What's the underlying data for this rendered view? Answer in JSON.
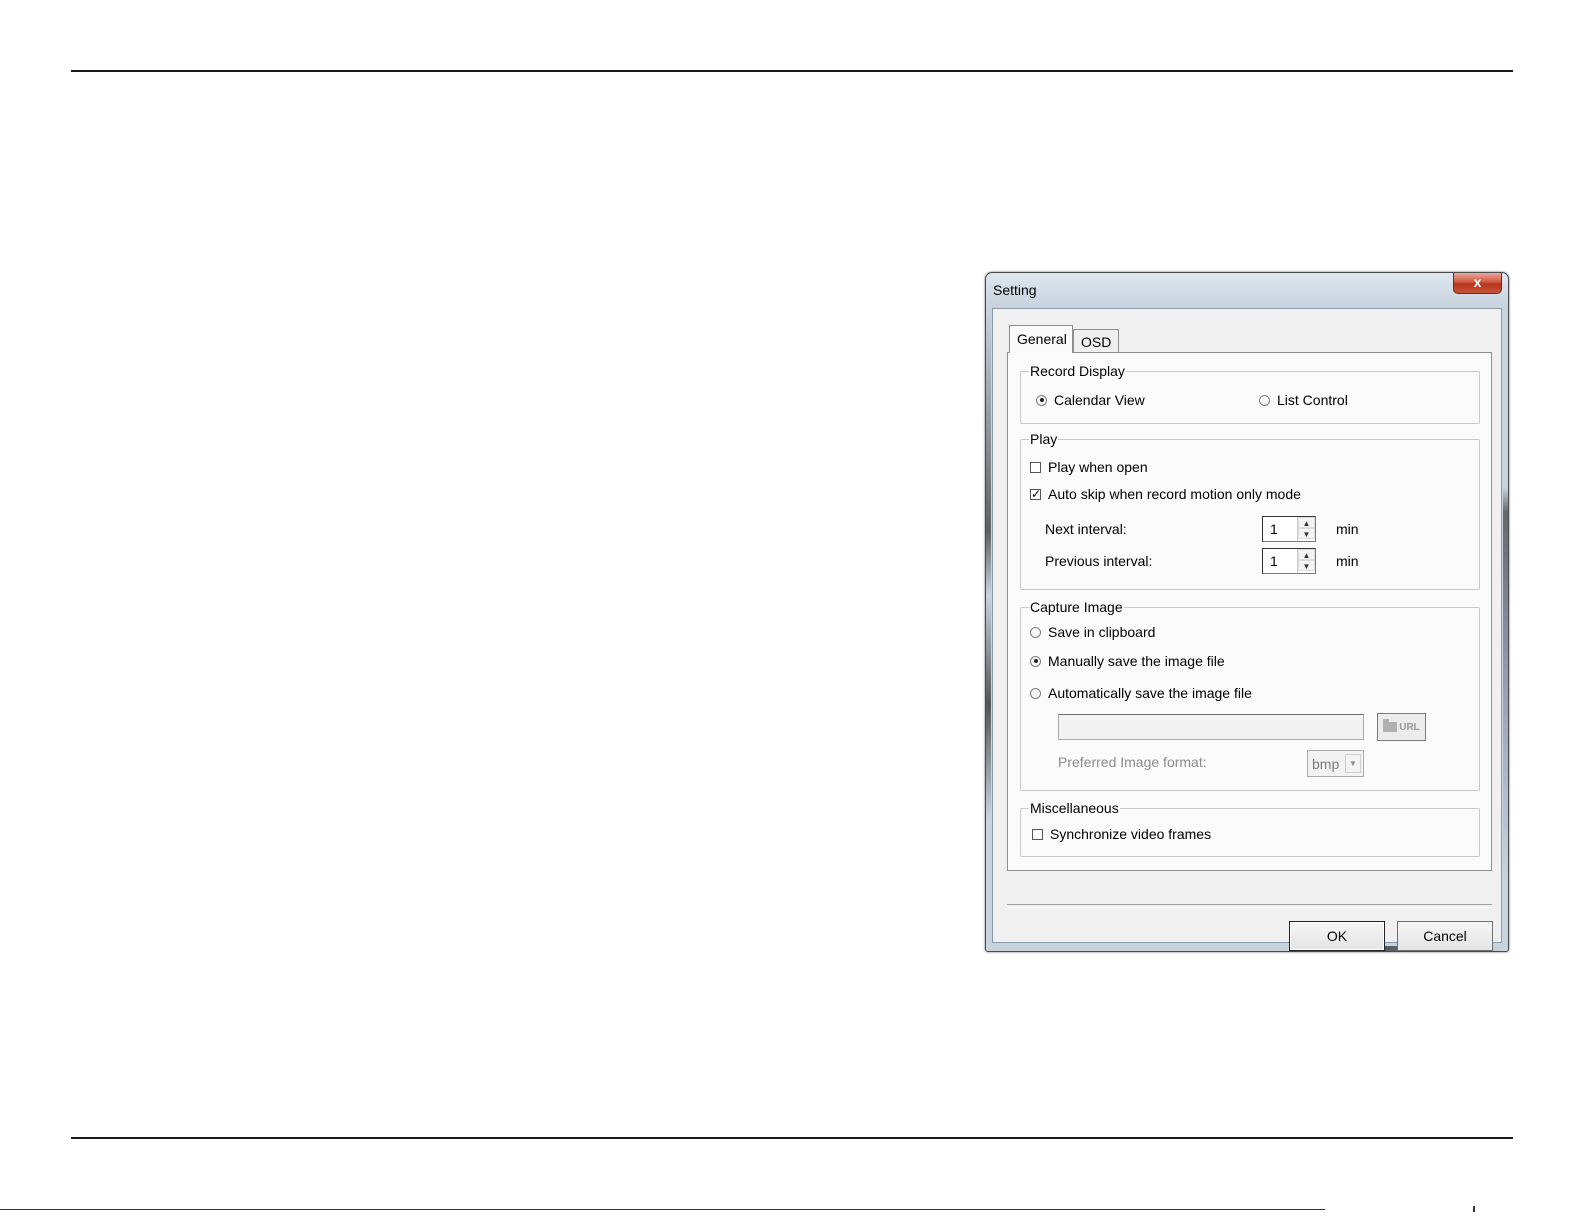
{
  "window": {
    "title": "Setting",
    "close_glyph": "x"
  },
  "tabs": [
    {
      "label": "General",
      "selected": true
    },
    {
      "label": "OSD",
      "selected": false
    }
  ],
  "record_display": {
    "label": "Record Display",
    "options": [
      {
        "label": "Calendar View",
        "selected": true
      },
      {
        "label": "List Control",
        "selected": false
      }
    ]
  },
  "play": {
    "label": "Play",
    "play_when_open": {
      "label": "Play when open",
      "checked": false
    },
    "auto_skip": {
      "label": "Auto skip when record motion only mode",
      "checked": true
    },
    "next_interval": {
      "label": "Next interval:",
      "value": "1",
      "unit": "min"
    },
    "previous_interval": {
      "label": "Previous interval:",
      "value": "1",
      "unit": "min"
    }
  },
  "capture_image": {
    "label": "Capture Image",
    "options": [
      {
        "label": "Save in clipboard",
        "selected": false
      },
      {
        "label": "Manually save the image file",
        "selected": true
      },
      {
        "label": "Automatically save the image file",
        "selected": false
      }
    ],
    "path_value": "",
    "browse_label": "URL",
    "format_label": "Preferred Image format:",
    "format_value": "bmp"
  },
  "misc": {
    "label": "Miscellaneous",
    "sync": {
      "label": "Synchronize video frames",
      "checked": false
    }
  },
  "buttons": {
    "ok": "OK",
    "cancel": "Cancel"
  },
  "glyphs": {
    "check_mark": "✓",
    "spin_up": "▲",
    "spin_down": "▼",
    "combo_arrow": "▼"
  },
  "icons": {
    "close": "close-icon",
    "folder": "folder-icon",
    "dropdown": "chevron-down-icon"
  },
  "colors": {
    "close_button": "#c8543c",
    "frame": "#c9d4de",
    "panel": "#fbfbfb"
  }
}
